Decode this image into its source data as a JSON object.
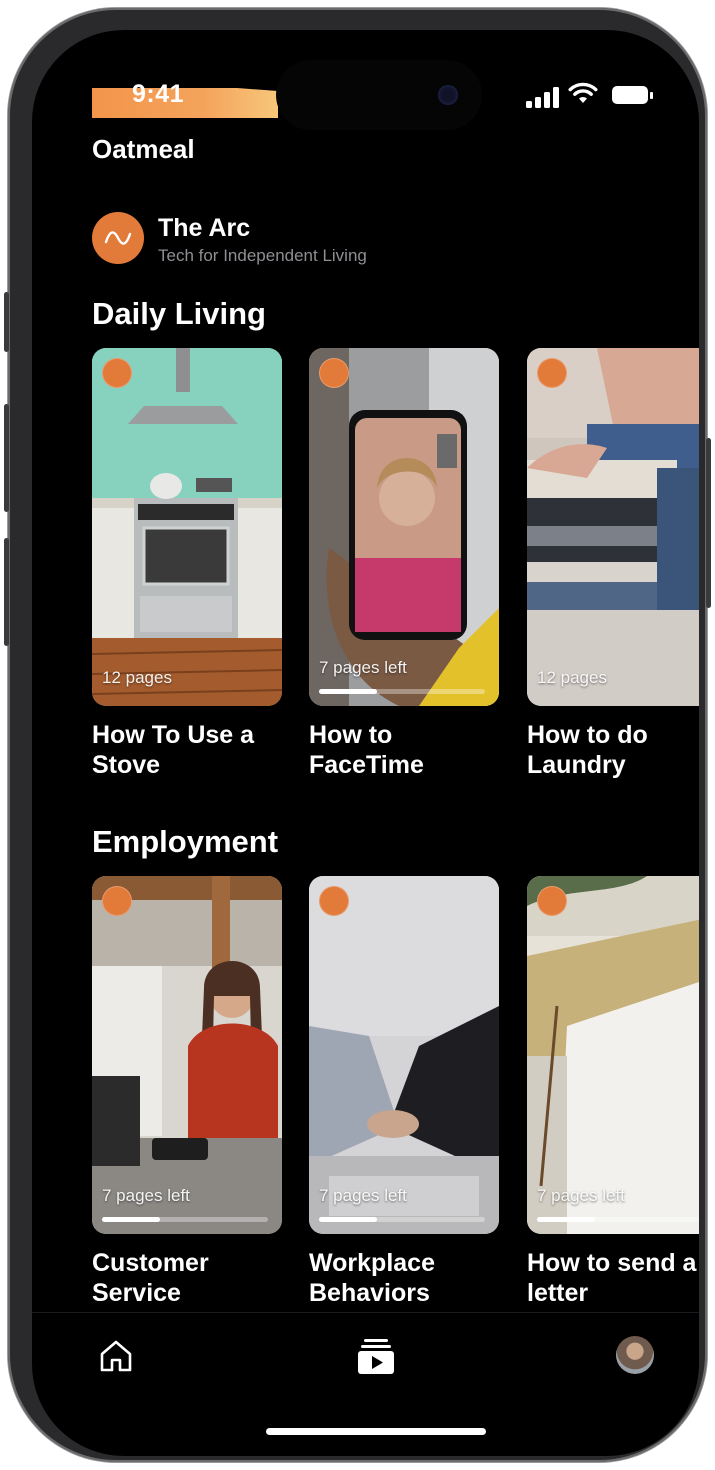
{
  "status_bar": {
    "time": "9:41"
  },
  "app_title": "Oatmeal",
  "organization": {
    "name": "The Arc",
    "tagline": "Tech for Independent Living"
  },
  "sections": [
    {
      "title": "Daily Living",
      "cards": [
        {
          "title_line1": "How To Use a",
          "title_line2": "Stove",
          "meta": "12 pages"
        },
        {
          "title_line1": "How to",
          "title_line2": "FaceTime",
          "meta": "7 pages left",
          "progress": 0.35
        },
        {
          "title_line1": "How to do",
          "title_line2": "Laundry",
          "meta": "12 pages"
        }
      ]
    },
    {
      "title": "Employment",
      "cards": [
        {
          "title_line1": "Customer",
          "title_line2": "Service",
          "meta": "7 pages left",
          "progress": 0.35
        },
        {
          "title_line1": "Workplace",
          "title_line2": "Behaviors",
          "meta": "7 pages left",
          "progress": 0.35
        },
        {
          "title_line1": "How to send a",
          "title_line2": "letter",
          "meta": "7 pages left",
          "progress": 0.35
        }
      ]
    }
  ],
  "tab_bar": {
    "items": [
      "home-icon",
      "library-icon",
      "profile-avatar"
    ]
  },
  "colors": {
    "accent": "#e27a3a",
    "background": "#000000",
    "muted_text": "#8e8e93"
  }
}
